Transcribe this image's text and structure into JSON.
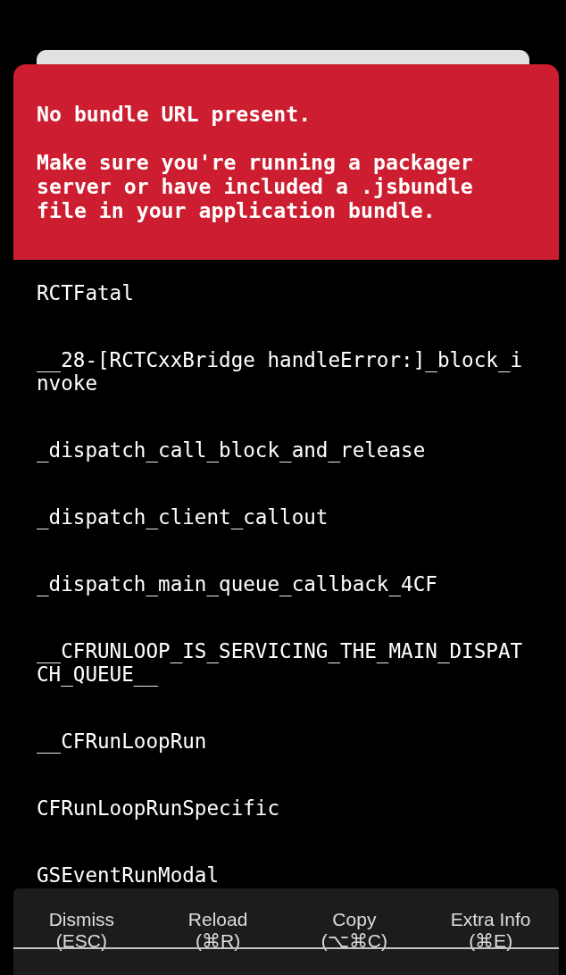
{
  "error": {
    "title": "No bundle URL present.",
    "message": "Make sure you're running a packager server or have included a .jsbundle file in your application bundle."
  },
  "stack_frames": [
    "RCTFatal",
    "__28-[RCTCxxBridge handleError:]_block_invoke",
    "_dispatch_call_block_and_release",
    "_dispatch_client_callout",
    "_dispatch_main_queue_callback_4CF",
    "__CFRUNLOOP_IS_SERVICING_THE_MAIN_DISPATCH_QUEUE__",
    "__CFRunLoopRun",
    "CFRunLoopRunSpecific",
    "GSEventRunModal"
  ],
  "buttons": [
    {
      "label": "Dismiss",
      "shortcut": "(ESC)"
    },
    {
      "label": "Reload",
      "shortcut": "(⌘R)"
    },
    {
      "label": "Copy",
      "shortcut": "(⌥⌘C)"
    },
    {
      "label": "Extra Info",
      "shortcut": "(⌘E)"
    }
  ]
}
